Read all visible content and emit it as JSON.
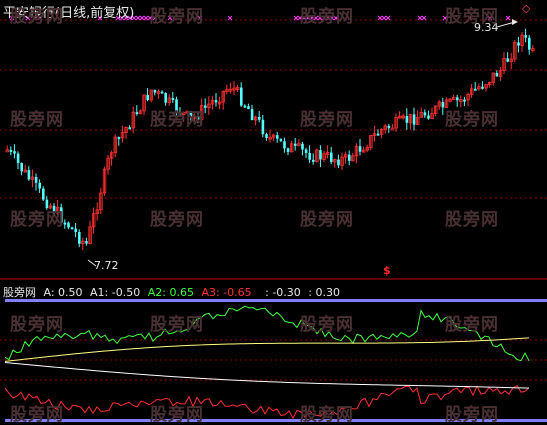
{
  "title": "平安银行(日线,前复权)",
  "high_label": "9.34",
  "low_label": "7.72",
  "watermark": "股旁网",
  "flag_glyph": "$",
  "indicator": {
    "name": "股旁网",
    "a": "A: 0.50",
    "a1": "A1: -0.50",
    "a2": "A2: 0.65",
    "a3": "A3: -0.65",
    "b1": ": -0.30",
    "b2": ": 0.30"
  },
  "colors": {
    "bg": "#000000",
    "up": "#ff3030",
    "down": "#54ffff",
    "grid": "#8b0000",
    "marker": "#ff40ff",
    "a2": "#40ff40",
    "a3": "#ff3030",
    "band": "#8080ff",
    "text": "#e8e8e8",
    "line_yellow": "#ffff80",
    "line_white": "#ffffff"
  },
  "icons": [
    "diamond-icon",
    "arrow-icon"
  ]
}
